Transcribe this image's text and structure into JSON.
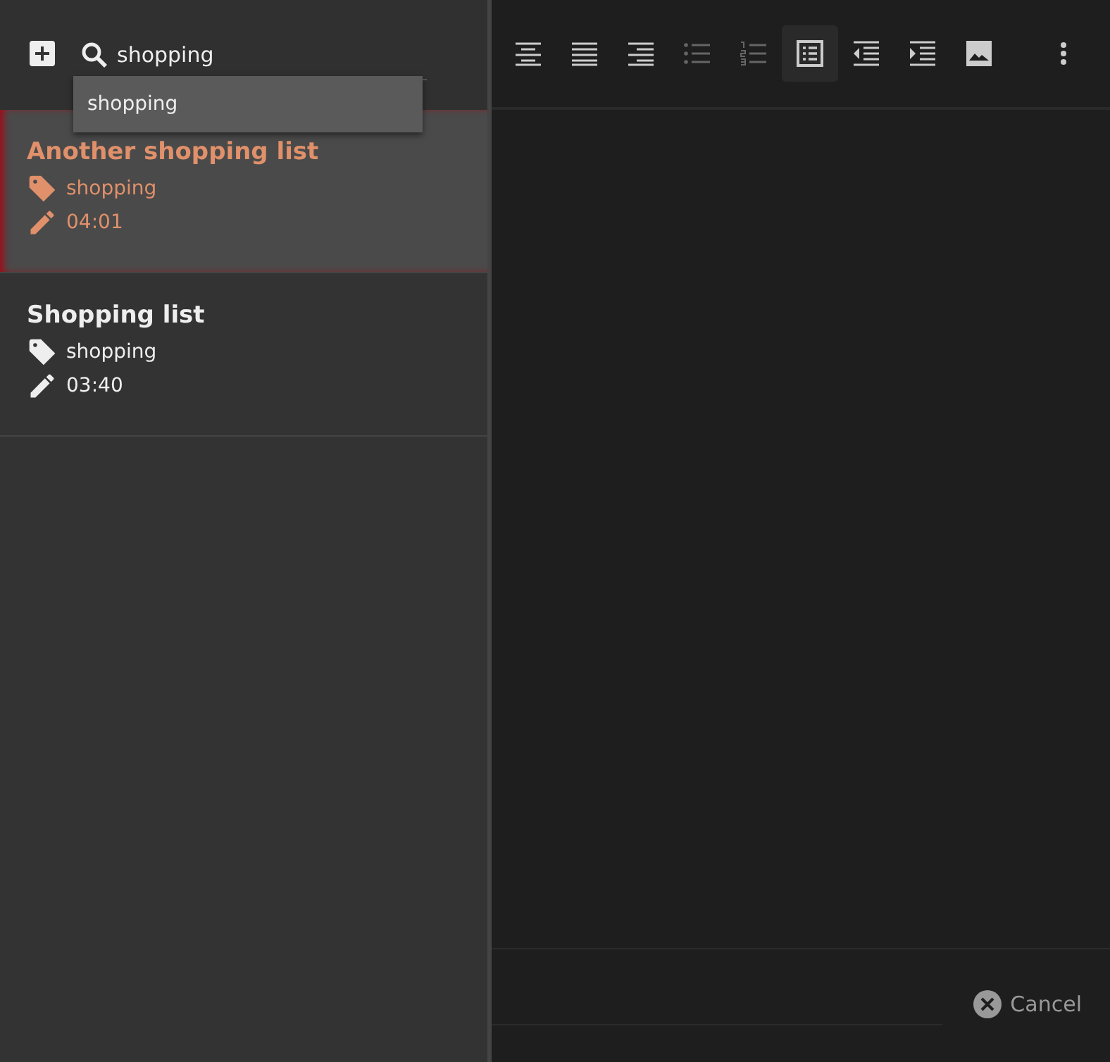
{
  "search": {
    "value": "shopping",
    "suggestions": [
      "shopping"
    ]
  },
  "notes": [
    {
      "title": "Another shopping list",
      "tag": "shopping",
      "time": "04:01",
      "selected": true
    },
    {
      "title": "Shopping list",
      "tag": "shopping",
      "time": "03:40",
      "selected": false
    }
  ],
  "toolbar": [
    {
      "kind": "align-center",
      "disabled": false,
      "selected": false
    },
    {
      "kind": "justify",
      "disabled": false,
      "selected": false
    },
    {
      "kind": "align-right",
      "disabled": false,
      "selected": false
    },
    {
      "kind": "bullet-list",
      "disabled": true,
      "selected": false
    },
    {
      "kind": "numbered-list",
      "disabled": true,
      "selected": false
    },
    {
      "kind": "checklist",
      "disabled": false,
      "selected": true
    },
    {
      "kind": "outdent",
      "disabled": false,
      "selected": false
    },
    {
      "kind": "indent",
      "disabled": false,
      "selected": false
    },
    {
      "kind": "image",
      "disabled": false,
      "selected": false
    },
    {
      "kind": "more",
      "disabled": false,
      "selected": false
    }
  ],
  "footer": {
    "cancel": "Cancel"
  }
}
